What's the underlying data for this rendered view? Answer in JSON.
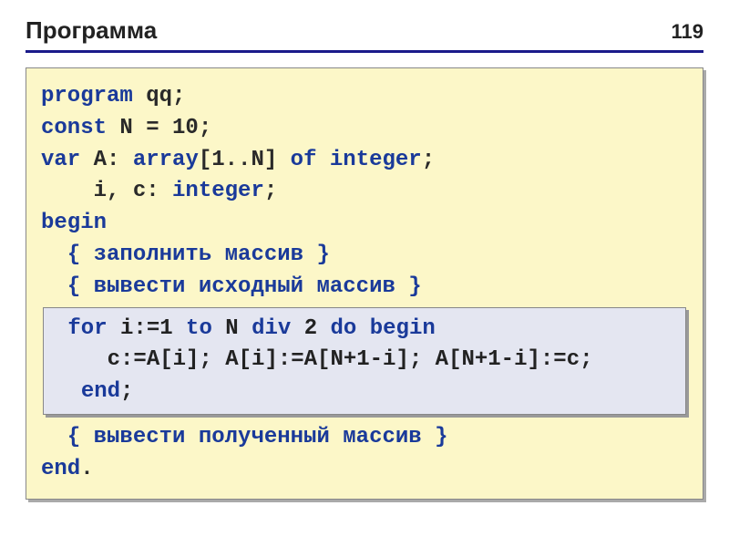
{
  "page_number": "119",
  "title": "Программа",
  "code": {
    "l1_kw": "program",
    "l1_rest": " qq;",
    "l2_kw": "const",
    "l2_rest": " N = 10;",
    "l3_kw": "var",
    "l3_mid": " A: ",
    "l3_kw2": "array",
    "l3_mid2": "[1..N] ",
    "l3_kw3": "of",
    "l3_mid3": " ",
    "l3_kw4": "integer",
    "l3_end": ";",
    "l4_pad": "    i, c: ",
    "l4_kw": "integer",
    "l4_end": ";",
    "l5_kw": "begin",
    "l6_pad": "  ",
    "l6_cmt": "{ заполнить массив }",
    "l7_pad": "  ",
    "l7_cmt": "{ вывести исходный массив }",
    "inner": {
      "l1_pad": " ",
      "l1_kw1": "for",
      "l1_m1": " i:=1 ",
      "l1_kw2": "to",
      "l1_m2": " N ",
      "l1_kw3": "div",
      "l1_m3": " 2 ",
      "l1_kw4": "do",
      "l1_m4": " ",
      "l1_kw5": "begin",
      "l2": "    c:=A[i]; A[i]:=A[N+1-i]; A[N+1-i]:=c;",
      "l3_pad": "  ",
      "l3_kw": "end",
      "l3_end": ";"
    },
    "l8_pad": "  ",
    "l8_cmt": "{ вывести полученный массив }",
    "l9_kw": "end",
    "l9_end": "."
  }
}
